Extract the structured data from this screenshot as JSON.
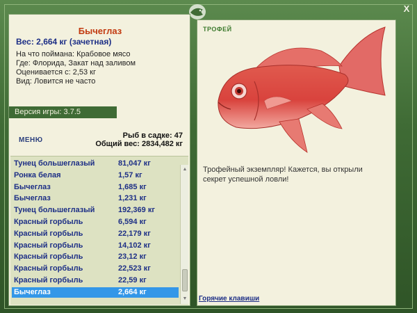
{
  "window": {
    "close_label": "X"
  },
  "fish": {
    "name": "Бычеглаз",
    "weight_line": "Вес: 2,664 кг (зачетная)",
    "bait_line": "На что поймана: Крабовое мясо",
    "where_line": "Где: Флорида, Закат над заливом",
    "value_line": "Оценивается с: 2,53 кг",
    "kind_line": "Вид: Ловится не часто"
  },
  "version": {
    "label": "Версия игры: 3.7.5"
  },
  "menu": {
    "label": "МЕНЮ"
  },
  "summary": {
    "count_line": "Рыб в садке: 47",
    "total_line": "Общий вес: 2834,482 кг"
  },
  "catch_list": [
    {
      "name": "Тунец большеглазый",
      "weight": "81,047 кг"
    },
    {
      "name": "Ронка белая",
      "weight": "1,57 кг"
    },
    {
      "name": "Бычеглаз",
      "weight": "1,685 кг"
    },
    {
      "name": "Бычеглаз",
      "weight": "1,231 кг"
    },
    {
      "name": "Тунец большеглазый",
      "weight": "192,369 кг"
    },
    {
      "name": "Красный горбыль",
      "weight": "6,594 кг"
    },
    {
      "name": "Красный горбыль",
      "weight": "22,179 кг"
    },
    {
      "name": "Красный горбыль",
      "weight": "14,102 кг"
    },
    {
      "name": "Красный горбыль",
      "weight": "23,12 кг"
    },
    {
      "name": "Красный горбыль",
      "weight": "22,523 кг"
    },
    {
      "name": "Красный горбыль",
      "weight": "22,59 кг"
    },
    {
      "name": "Бычеглаз",
      "weight": "2,664 кг",
      "selected": true
    }
  ],
  "trophy": {
    "label": "ТРОФЕЙ",
    "text": "Трофейный экземпляр! Кажется, вы открыли секрет успешной ловли!",
    "image_icon": "red-bigeye-fish-illustration"
  },
  "hotkeys": {
    "label": "Горячие клавиши"
  },
  "colors": {
    "frame_green": "#3f6b35",
    "panel_bg": "#f3f1de",
    "title_red": "#c23a10",
    "list_text_blue": "#1d2f86",
    "selected_row": "#3397e8"
  }
}
